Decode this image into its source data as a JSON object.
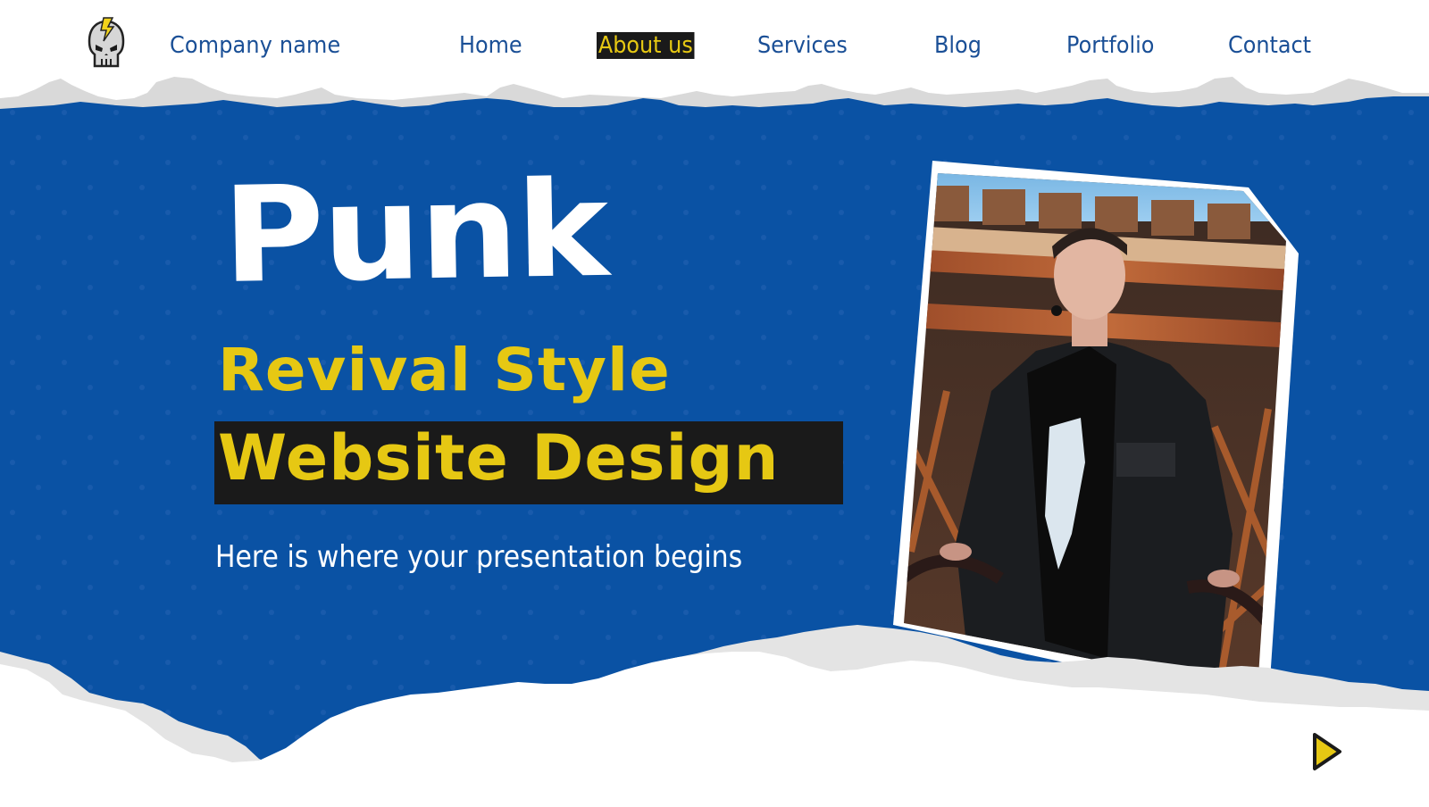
{
  "header": {
    "logo_icon": "skull-lightning-icon",
    "company_name": "Company name",
    "nav": [
      {
        "label": "Home",
        "active": false
      },
      {
        "label": "About us",
        "active": true
      },
      {
        "label": "Services",
        "active": false
      },
      {
        "label": "Blog",
        "active": false
      },
      {
        "label": "Portfolio",
        "active": false
      },
      {
        "label": "Contact",
        "active": false
      }
    ]
  },
  "hero": {
    "title_line1": "Punk",
    "title_line2": "Revival Style",
    "title_line3": "Website Design",
    "subtitle": "Here is where your presentation begins",
    "photo_alt": "Person with shaved head in black leather jacket under rusty metal structure"
  },
  "controls": {
    "next_icon": "play-triangle-icon"
  },
  "colors": {
    "brand_blue": "#0a52a4",
    "accent_yellow": "#e6c813",
    "text_blue": "#1a4f96",
    "highlight_black": "#1a1a1a",
    "torn_gray": "#d9d9d9"
  }
}
